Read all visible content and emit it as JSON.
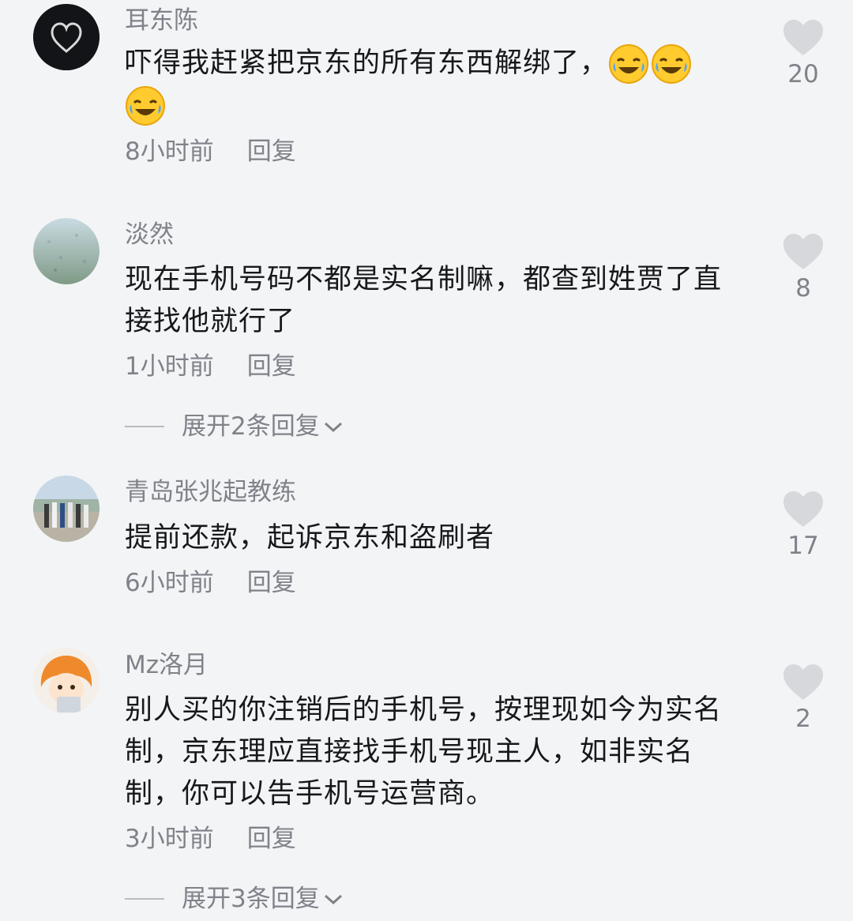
{
  "comments": [
    {
      "username": "耳东陈",
      "text": "吓得我赶紧把京东的所有东西解绑了，",
      "emojis": [
        "laugh-cry-emoji",
        "laugh-cry-emoji",
        "laugh-cry-emoji"
      ],
      "time": "8小时前",
      "reply": "回复",
      "likes": "20"
    },
    {
      "username": "淡然",
      "text": "现在手机号码不都是实名制嘛，都查到姓贾了直接找他就行了",
      "time": "1小时前",
      "reply": "回复",
      "likes": "8",
      "expand": "展开2条回复"
    },
    {
      "username": "青岛张兆起教练",
      "text": "提前还款，起诉京东和盗刷者",
      "time": "6小时前",
      "reply": "回复",
      "likes": "17"
    },
    {
      "username": "Mz洛月",
      "text": "别人买的你注销后的手机号，按理现如今为实名制，京东理应直接找手机号现主人，如非实名制，你可以告手机号运营商。",
      "time": "3小时前",
      "reply": "回复",
      "likes": "2",
      "expand": "展开3条回复"
    }
  ],
  "colors": {
    "background": "#f3f4f6",
    "secondary_text": "#7f8389",
    "primary_text": "#17181a",
    "heart": "#d6d8dc"
  }
}
